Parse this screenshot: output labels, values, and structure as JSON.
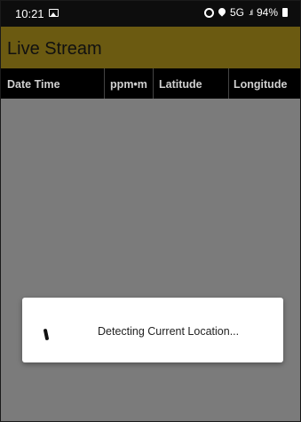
{
  "status_bar": {
    "time": "10:21",
    "network": "5G",
    "signal": ".ıl",
    "battery": "94%"
  },
  "app_bar": {
    "title": "Live Stream"
  },
  "table": {
    "columns": [
      "Date Time",
      "ppm•m",
      "Latitude",
      "Longitude"
    ],
    "rows": []
  },
  "dialog": {
    "message": "Detecting Current Location..."
  },
  "colors": {
    "app_bar": "#6b5a11",
    "header": "#000000",
    "overlay": "#7b7b7b"
  }
}
